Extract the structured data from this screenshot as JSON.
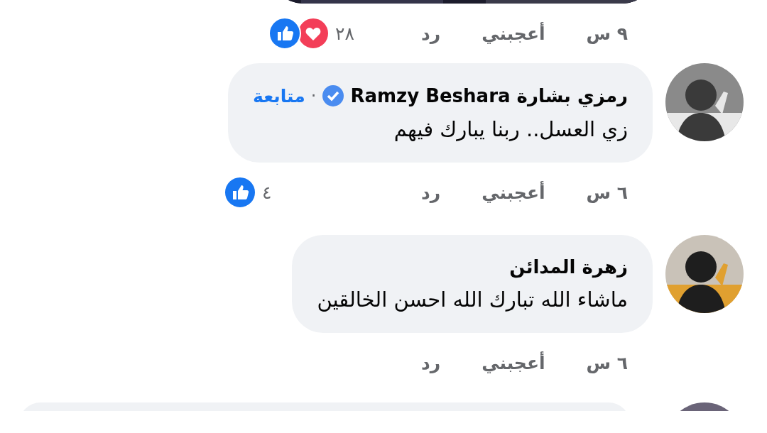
{
  "top_post": {
    "image": {
      "kind": "picture"
    },
    "time": "٩ س",
    "like": "أعجبني",
    "reply": "رد",
    "reaction_count": "٢٨",
    "reactions": [
      {
        "kind": "love"
      },
      {
        "kind": "like"
      }
    ]
  },
  "comments": [
    {
      "avatar": {
        "kind": "picture"
      },
      "author": "رمزي بشارة Ramzy Beshara",
      "verified": true,
      "separator": "·",
      "follow": "متابعة",
      "text": "زي العسل.. ربنا يبارك فيهم",
      "time": "٦ س",
      "like": "أعجبني",
      "reply": "رد",
      "reaction_count": "٤",
      "reactions": [
        {
          "kind": "like"
        }
      ]
    },
    {
      "avatar": {
        "kind": "picture"
      },
      "author": "زهرة المدائن",
      "verified": false,
      "text": "ماشاء الله تبارك الله احسن الخالقين",
      "time": "٦ س",
      "like": "أعجبني",
      "reply": "رد"
    }
  ],
  "next_comment": {
    "avatar": {
      "kind": "picture"
    }
  }
}
